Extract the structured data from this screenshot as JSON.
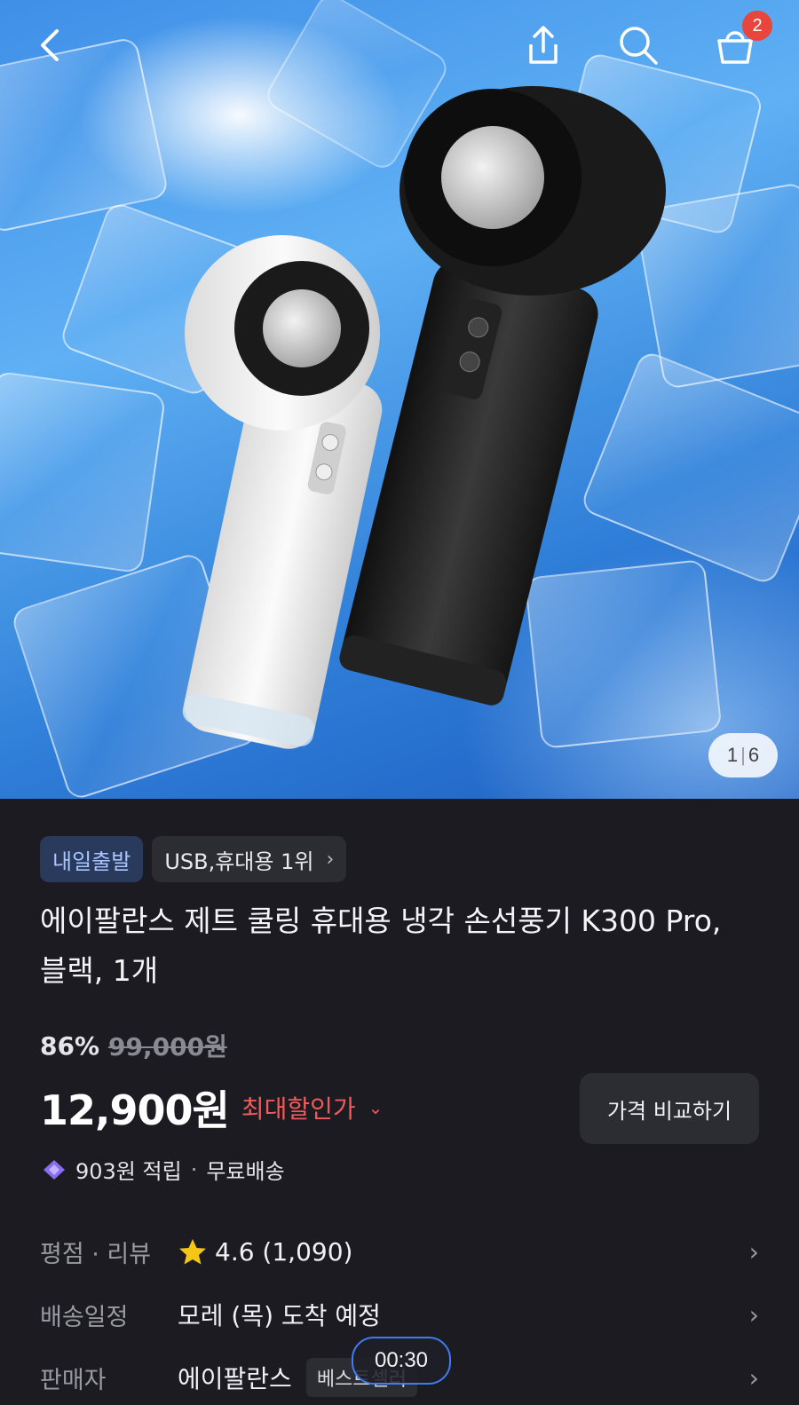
{
  "header": {
    "back_icon": "chevron-left-icon",
    "share_icon": "share-icon",
    "search_icon": "search-icon",
    "cart_icon": "cart-icon",
    "cart_count": "2"
  },
  "gallery": {
    "current": "1",
    "total": "6",
    "description": "product-image"
  },
  "chips": {
    "delivery": "내일출발",
    "ranking": "USB,휴대용 1위"
  },
  "product": {
    "title": "에이팔란스 제트 쿨링 휴대용 냉각 손선풍기 K300 Pro, 블랙, 1개"
  },
  "pricing": {
    "discount_rate": "86%",
    "original_price": "99,000원",
    "price": "12,900원",
    "max_discount_label": "최대할인가",
    "compare_button": "가격 비교하기",
    "reward": "903원 적립",
    "shipping": "무료배송"
  },
  "info": {
    "rating_label": "평점 · 리뷰",
    "rating_value": "4.6 (1,090)",
    "delivery_label": "배송일정",
    "delivery_value": "모레 (목) 도착 예정",
    "seller_label": "판매자",
    "seller_value": "에이팔란스",
    "seller_badge": "베스트셀러"
  },
  "overlay": {
    "timer": "00:30"
  },
  "colors": {
    "accent_red": "#f05a5a",
    "badge_red": "#e8453c",
    "chip_blue_text": "#a9c6ff",
    "background": "#1c1b22"
  }
}
